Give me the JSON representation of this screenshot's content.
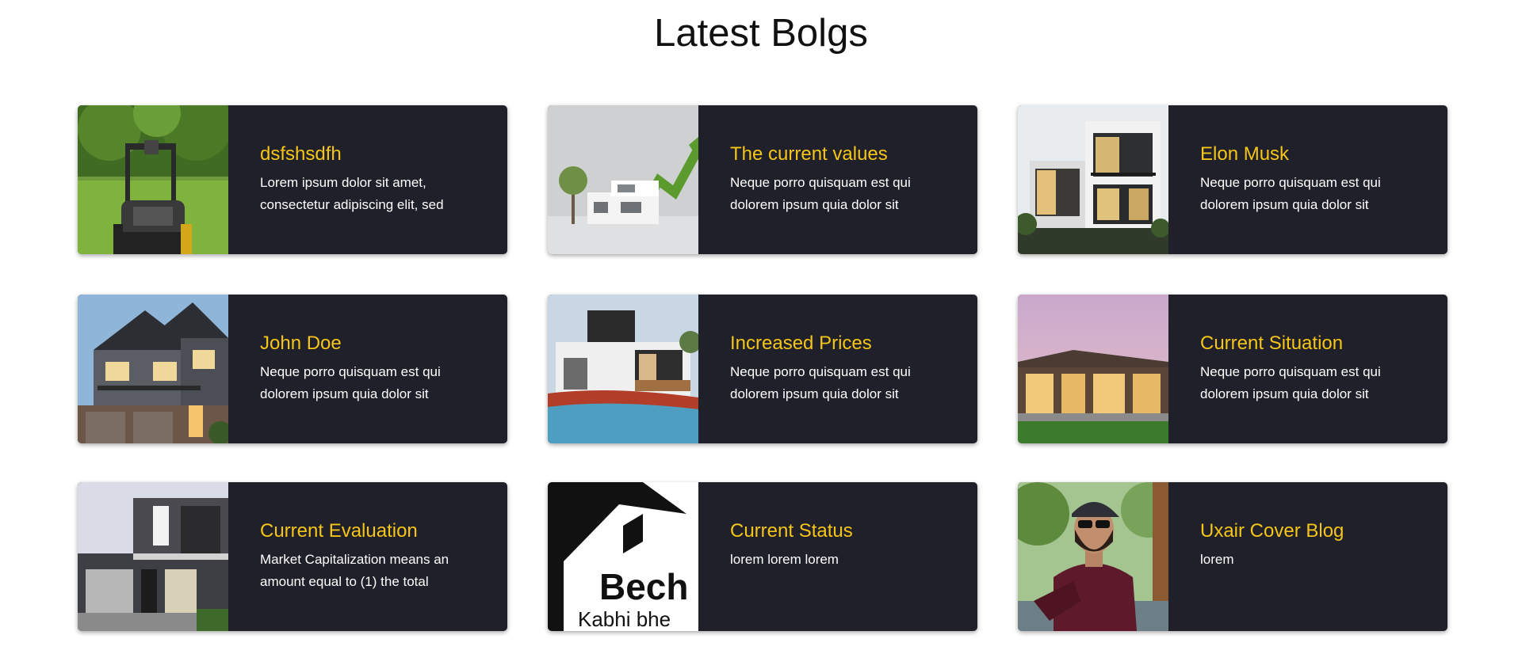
{
  "page": {
    "title": "Latest Bolgs"
  },
  "colors": {
    "card_bg": "#1f2029",
    "title_accent": "#f5c518",
    "text": "#ffffff"
  },
  "posts": [
    {
      "title": "dsfshsdfh",
      "excerpt": "Lorem ipsum dolor sit amet, consectetur adipiscing elit, sed",
      "image": "lawn-mower-photo"
    },
    {
      "title": "The current values",
      "excerpt": "Neque porro quisquam est qui dolorem ipsum quia dolor sit",
      "image": "house-model-chart-photo"
    },
    {
      "title": "Elon Musk",
      "excerpt": "Neque porro quisquam est qui dolorem ipsum quia dolor sit",
      "image": "modern-villa-photo"
    },
    {
      "title": "John Doe",
      "excerpt": "Neque porro quisquam est qui dolorem ipsum quia dolor sit",
      "image": "stone-house-photo"
    },
    {
      "title": "Increased Prices",
      "excerpt": "Neque porro quisquam est qui dolorem ipsum quia dolor sit",
      "image": "pool-house-photo"
    },
    {
      "title": "Current Situation",
      "excerpt": "Neque porro quisquam est qui dolorem ipsum quia dolor sit",
      "image": "dusk-house-photo"
    },
    {
      "title": "Current Evaluation",
      "excerpt": "Market Capitalization means an amount equal to (1) the total",
      "image": "dark-house-photo"
    },
    {
      "title": "Current Status",
      "excerpt": "lorem lorem lorem",
      "image": "bech-logo-image",
      "logo_text": "Bech",
      "logo_subtext": "Kabhi bhe"
    },
    {
      "title": "Uxair Cover Blog",
      "excerpt": "lorem",
      "image": "man-portrait-photo"
    }
  ]
}
